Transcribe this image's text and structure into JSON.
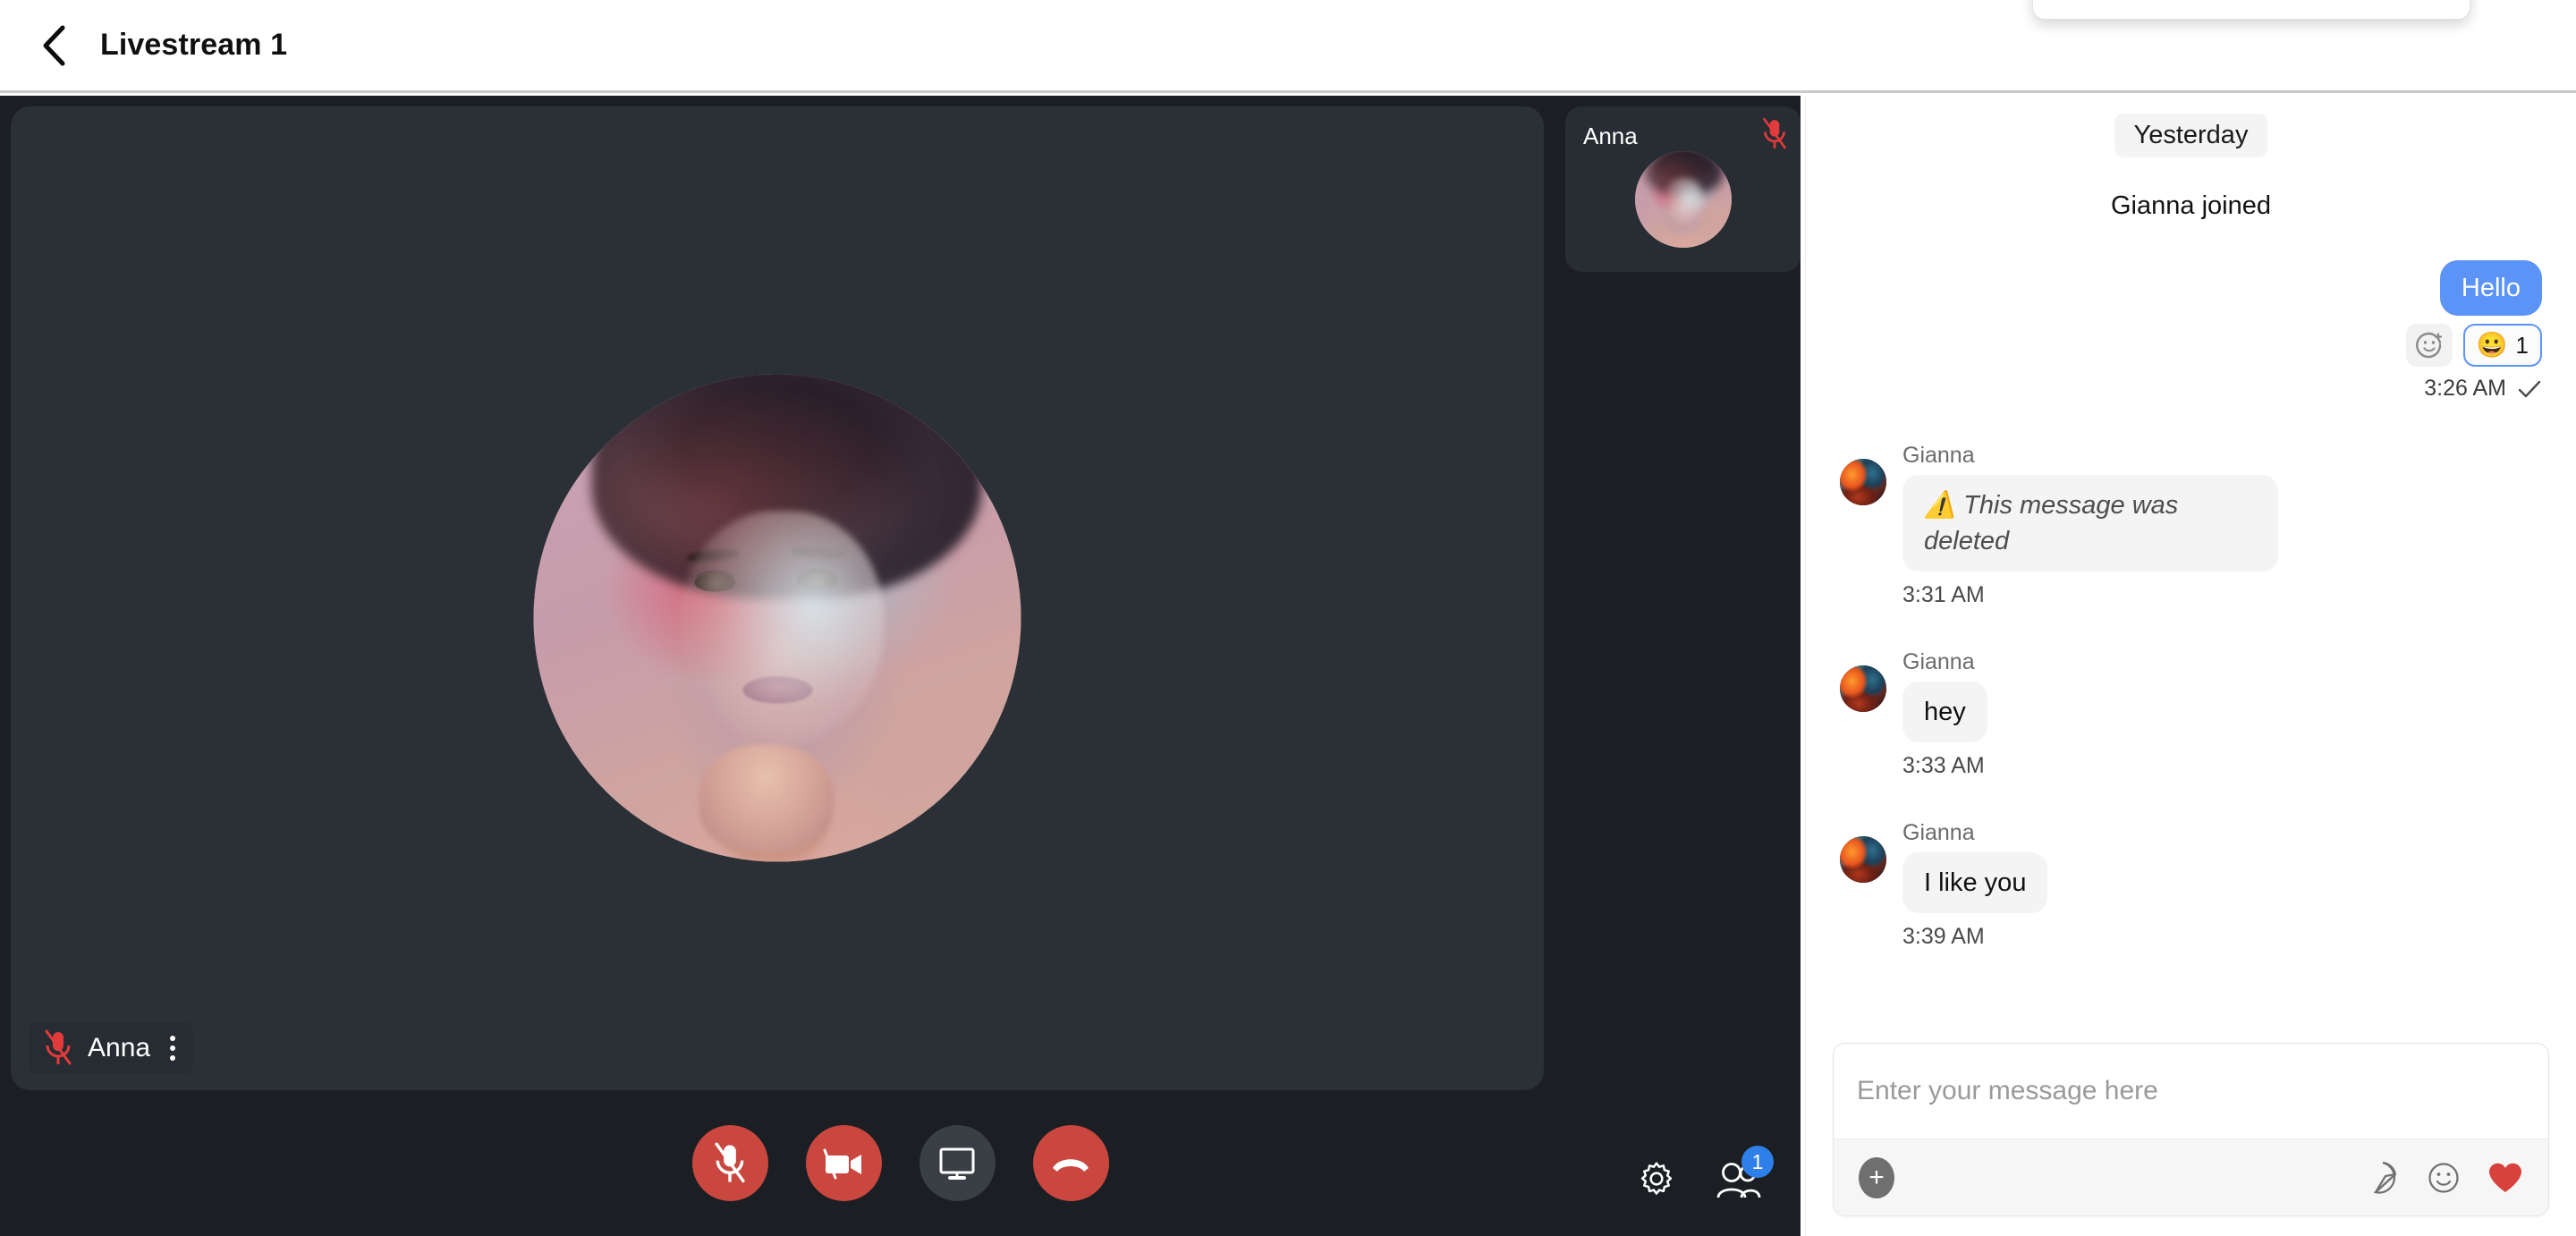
{
  "header": {
    "back_icon": "chevron-left-icon",
    "title": "Livestream 1"
  },
  "stage": {
    "participant_name": "Anna",
    "mic_status_icon": "microphone-muted-icon",
    "more_icon": "kebab-menu-icon"
  },
  "thumbnail": {
    "name": "Anna",
    "mic_status_icon": "microphone-muted-icon"
  },
  "controls": {
    "mic": {
      "label": "Mute microphone",
      "icon": "microphone-muted-icon",
      "state": "off",
      "color": "#c9473f"
    },
    "camera": {
      "label": "Stop camera",
      "icon": "video-camera-off-icon",
      "state": "off",
      "color": "#c9473f"
    },
    "screen": {
      "label": "Share screen",
      "icon": "monitor-icon",
      "state": "idle",
      "color": "#3a3f45"
    },
    "hangup": {
      "label": "End call",
      "icon": "phone-hangup-icon",
      "state": "on",
      "color": "#c9473f"
    },
    "settings": {
      "label": "Settings",
      "icon": "gear-icon"
    },
    "participants": {
      "label": "Participants",
      "icon": "people-icon",
      "badge": "1",
      "badge_color": "#2f7fe8"
    }
  },
  "chat": {
    "day_separator": "Yesterday",
    "system_message": "Gianna joined",
    "outgoing": {
      "text": "Hello",
      "time": "3:26 AM",
      "status_icon": "check-sent-icon",
      "add_reaction_icon": "add-reaction-icon",
      "reaction_emoji": "😀",
      "reaction_count": "1",
      "bubble_color": "#5b93f7"
    },
    "messages": [
      {
        "sender": "Gianna",
        "text": "⚠️ This message was deleted",
        "time": "3:31 AM",
        "deleted": true
      },
      {
        "sender": "Gianna",
        "text": "hey",
        "time": "3:33 AM",
        "deleted": false
      },
      {
        "sender": "Gianna",
        "text": "I like you",
        "time": "3:39 AM",
        "deleted": false
      }
    ],
    "composer": {
      "placeholder": "Enter your message here",
      "value": "",
      "attach_icon": "plus-icon",
      "sticker_icon": "sticker-icon",
      "emoji_icon": "smiley-icon",
      "heart_icon": "heart-icon",
      "heart_color": "#d8423c"
    }
  }
}
